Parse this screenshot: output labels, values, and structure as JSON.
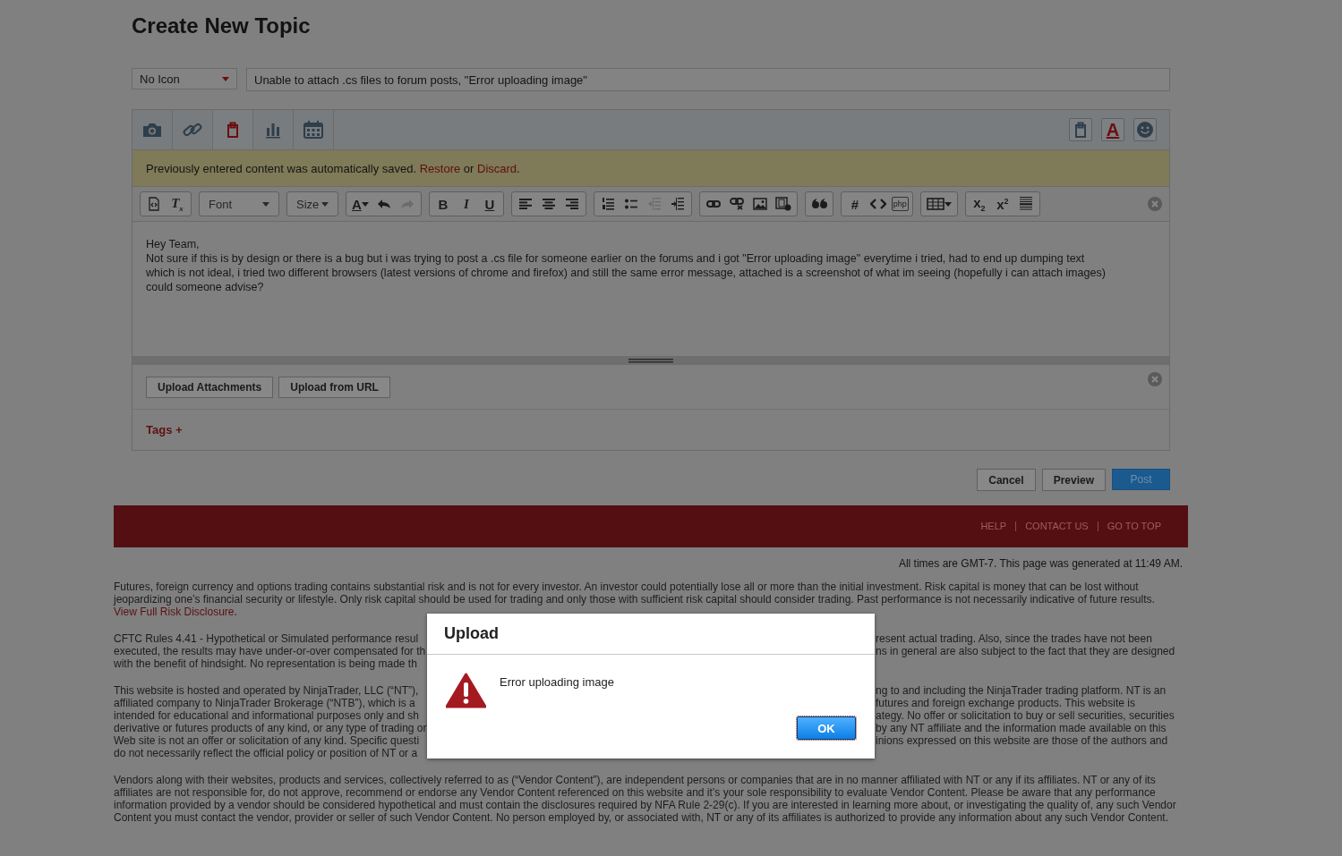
{
  "page_title": "Create New Topic",
  "icon_select": {
    "value": "No Icon"
  },
  "subject_field": {
    "value": "Unable to attach .cs files to forum posts, \"Error uploading image\""
  },
  "insert_tabs": [
    {
      "selected": false
    },
    {
      "selected": false
    },
    {
      "selected": true
    },
    {
      "selected": false
    },
    {
      "selected": false
    }
  ],
  "side_tools": [
    {
      "kind": "icon"
    },
    {
      "kind": "text",
      "label": "A"
    },
    {
      "kind": "icon"
    }
  ],
  "autosave_notice": {
    "text": "Previously entered content was automatically saved.",
    "restore_link": "Restore",
    "joiner": "or",
    "discard_link": "Discard",
    "end": "."
  },
  "toolbar": [
    {
      "items": [
        {
          "kind": "icon",
          "disabled": false
        },
        {
          "kind": "text",
          "label": "T$_{x}$",
          "disabled": false
        }
      ]
    },
    {
      "items": [
        {
          "kind": "select",
          "label": "Font",
          "disabled": false
        }
      ]
    },
    {
      "items": [
        {
          "kind": "select",
          "label": "Size",
          "disabled": false
        }
      ]
    },
    {
      "items": [
        {
          "kind": "textmenu",
          "label": "A",
          "disabled": false
        },
        {
          "kind": "icon",
          "disabled": false
        },
        {
          "kind": "icon",
          "disabled": true
        }
      ]
    },
    {
      "items": [
        {
          "kind": "text",
          "label": "B",
          "disabled": false
        },
        {
          "kind": "text",
          "label": "I",
          "disabled": false
        },
        {
          "kind": "text",
          "label": "U",
          "disabled": false
        }
      ]
    },
    {
      "items": [
        {
          "kind": "icon",
          "disabled": false
        },
        {
          "kind": "icon",
          "disabled": false
        },
        {
          "kind": "icon",
          "disabled": false
        }
      ]
    },
    {
      "items": [
        {
          "kind": "icon",
          "disabled": false
        },
        {
          "kind": "icon",
          "disabled": false
        },
        {
          "kind": "icon",
          "disabled": true
        },
        {
          "kind": "icon",
          "disabled": false
        }
      ]
    },
    {
      "items": [
        {
          "kind": "icon",
          "disabled": false
        },
        {
          "kind": "icon",
          "disabled": false
        },
        {
          "kind": "icon",
          "disabled": false
        },
        {
          "kind": "icon",
          "disabled": false
        }
      ]
    },
    {
      "items": [
        {
          "kind": "icon",
          "disabled": false
        }
      ]
    },
    {
      "items": [
        {
          "kind": "text",
          "label": "#",
          "disabled": false
        },
        {
          "kind": "icon",
          "disabled": false
        },
        {
          "kind": "text",
          "label": "php",
          "disabled": false
        }
      ]
    },
    {
      "items": [
        {
          "kind": "iconmenu",
          "disabled": false
        }
      ]
    },
    {
      "items": [
        {
          "kind": "text",
          "label": "x$_{2}$",
          "disabled": false
        },
        {
          "kind": "text",
          "label": "x$^{2}$",
          "disabled": false
        },
        {
          "kind": "icon",
          "disabled": false
        }
      ]
    }
  ],
  "message_lines": [
    "Hey Team,",
    "Not sure if this is by design or there is a bug but i was trying to post a .cs file for someone earlier on the forums and i got \"Error uploading image\" everytime i tried, had to end up dumping text",
    "which is not ideal, i tried two different browsers (latest versions of chrome and firefox) and still the same error message, attached is a screenshot of what im seeing (hopefully i can attach images)",
    "could someone advise?"
  ],
  "attachment_buttons": [
    "Upload Attachments",
    "Upload from URL"
  ],
  "tags_link": "Tags +",
  "actions": [
    {
      "label": "Cancel",
      "kind": "default"
    },
    {
      "label": "Preview",
      "kind": "default"
    },
    {
      "label": "Post",
      "kind": "primary"
    }
  ],
  "footer_links": [
    "HELP",
    "CONTACT US",
    "GO TO TOP"
  ],
  "timestamp": "All times are GMT-7. This page was generated at 11:49 AM.",
  "risk_notice": {
    "text": "Futures, foreign currency and options trading contains substantial risk and is not for every investor. An investor could potentially lose all or more than the initial investment. Risk capital is money that can be lost without jeopardizing one’s financial security or lifestyle. Only risk capital should be used for trading and only those with sufficient risk capital should consider trading. Past performance is not necessarily indicative of future results.",
    "link": "View Full Risk Disclosure",
    "end": "."
  },
  "partly_covered_paragraphs": [
    {
      "lines": [
        {
          "left": "CFTC Rules 4.41 - Hypothetical or Simulated performance resul",
          "right": "resent actual trading. Also, since the trades have not been"
        },
        {
          "left": "executed, the results may have under-or-over compensated for th",
          "right": "ns in general are also subject to the fact that they are designed"
        },
        {
          "left": "with the benefit of hindsight. No representation is being made th"
        }
      ]
    },
    {
      "lines": [
        {
          "left": "This website is hosted and operated by NinjaTrader, LLC (“NT”),",
          "right": "ng to and including the NinjaTrader trading platform. NT is an"
        },
        {
          "left": "affiliated company to NinjaTrader Brokerage (“NTB”), which is a",
          "right": "futures and foreign exchange products. This website is"
        },
        {
          "left": "intended for educational and informational purposes only and sh",
          "right": "ategy. No offer or solicitation to buy or sell securities, securities"
        },
        {
          "left": "derivative or futures products of any kind, or any type of trading or",
          "right": "by any NT affiliate and the information made available on this"
        },
        {
          "left": "Web site is not an offer or solicitation of any kind. Specific questi",
          "right": "inions expressed on this website are those of the authors and"
        },
        {
          "left": "do not necessarily reflect the official policy or position of NT or a"
        }
      ]
    }
  ],
  "vendor_notice": "Vendors along with their websites, products and services, collectively referred to as (“Vendor Content”), are independent persons or companies that are in no manner affiliated with NT or any if its affiliates. NT or any of its affiliates are not responsible for, do not approve, recommend or endorse any Vendor Content referenced on this website and it’s your sole responsibility to evaluate Vendor Content. Please be aware that any performance information provided by a vendor should be considered hypothetical and must contain the disclosures required by NFA Rule 2-29(c). If you are interested in learning more about, or investigating the quality of, any such Vendor Content you must contact the vendor, provider or seller of such Vendor Content. No person employed by, or associated with, NT or any of its affiliates is authorized to provide any information about any such Vendor Content.",
  "dialog": {
    "title": "Upload",
    "message": "Error uploading image",
    "button": "OK"
  }
}
